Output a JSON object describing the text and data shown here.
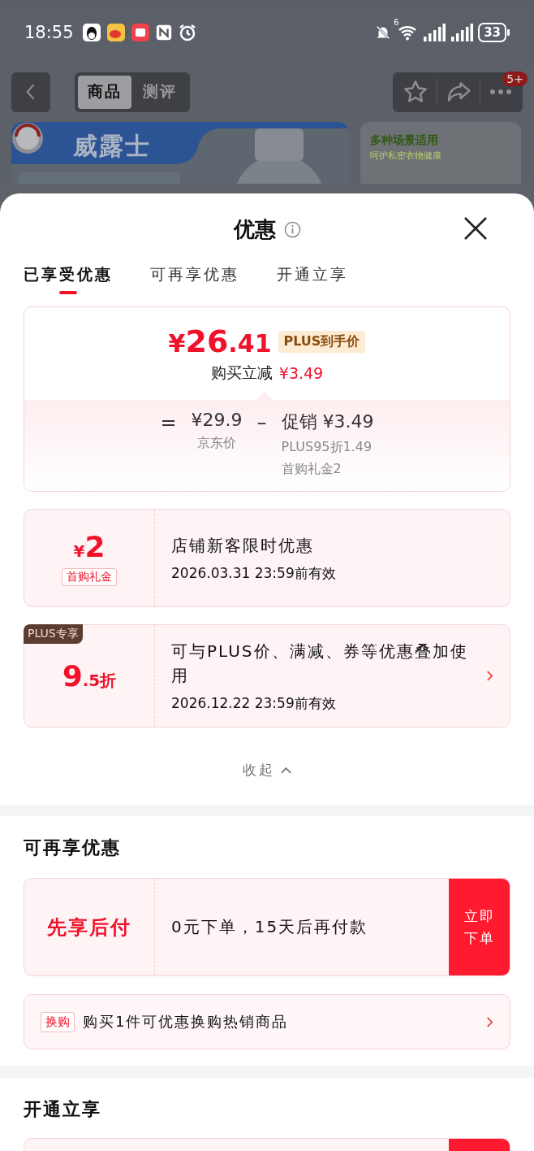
{
  "status_bar": {
    "time": "18:55",
    "wifi_label": "6",
    "battery": "33"
  },
  "header": {
    "tabs": [
      {
        "label": "商品",
        "selected": true
      },
      {
        "label": "测评",
        "selected": false
      }
    ],
    "badge": "5+"
  },
  "product": {
    "brand": "威露士",
    "side_title": "多种场景适用",
    "side_subtitle": "呵护私密衣物健康"
  },
  "sheet": {
    "title": "优惠",
    "tabs": [
      {
        "label": "已享受优惠",
        "selected": true
      },
      {
        "label": "可再享优惠",
        "selected": false
      },
      {
        "label": "开通立享",
        "selected": false
      }
    ],
    "price_card": {
      "price_symbol": "¥",
      "price_int": "26",
      "price_dec": ".41",
      "tag": "PLUS到手价",
      "reduce_label": "购买立减",
      "reduce_amount": "¥3.49",
      "equals": "=",
      "base_price": "¥29.9",
      "base_label": "京东价",
      "minus": "–",
      "promo_label": "促销",
      "promo_amount": "¥3.49",
      "promo_details": [
        "PLUS95折1.49",
        "首购礼金2"
      ]
    },
    "coupons": [
      {
        "kind": "amount",
        "symbol": "¥",
        "value": "2",
        "tag": "首购礼金",
        "title": "店铺新客限时优惠",
        "validity": "2026.03.31  23:59前有效",
        "chevron": false
      },
      {
        "kind": "discount",
        "badge": "PLUS专享",
        "value": "9",
        "unit": ".5折",
        "title": "可与PLUS价、满减、券等优惠叠加使用",
        "validity": "2026.12.22  23:59前有效",
        "chevron": true
      }
    ],
    "collapse": "收起"
  },
  "more_offers": {
    "heading": "可再享优惠",
    "pay_later": {
      "label": "先享后付",
      "text": "0元下单，15天后再付款",
      "button": "立即下单"
    },
    "exchange": {
      "tag": "换购",
      "text": "购买1件可优惠换购热销商品"
    }
  },
  "open_offers": {
    "heading": "开通立享"
  }
}
